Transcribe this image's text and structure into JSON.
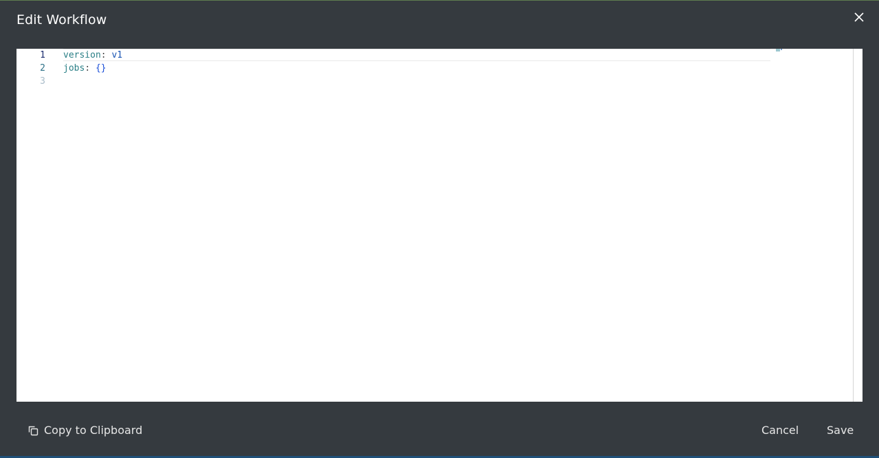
{
  "dialog": {
    "title": "Edit Workflow",
    "close_icon": "close-icon"
  },
  "editor": {
    "active_line": 1,
    "lines": [
      {
        "number": "1",
        "key": "version",
        "sep": ": ",
        "value": "v1"
      },
      {
        "number": "2",
        "key": "jobs",
        "sep": ": ",
        "value": "{}"
      },
      {
        "number": "3",
        "key": "",
        "sep": "",
        "value": ""
      }
    ]
  },
  "footer": {
    "copy_label": "Copy to Clipboard",
    "copy_icon": "copy-icon",
    "cancel_label": "Cancel",
    "save_label": "Save"
  },
  "colors": {
    "dialog_bg": "#353a3f",
    "editor_bg": "#ffffff",
    "key_color": "#2a7f86",
    "value_color": "#1a55b3",
    "line_number_active": "#1a2b6d",
    "line_number": "#2a6f86",
    "line_number_empty": "#a9bcc9"
  }
}
